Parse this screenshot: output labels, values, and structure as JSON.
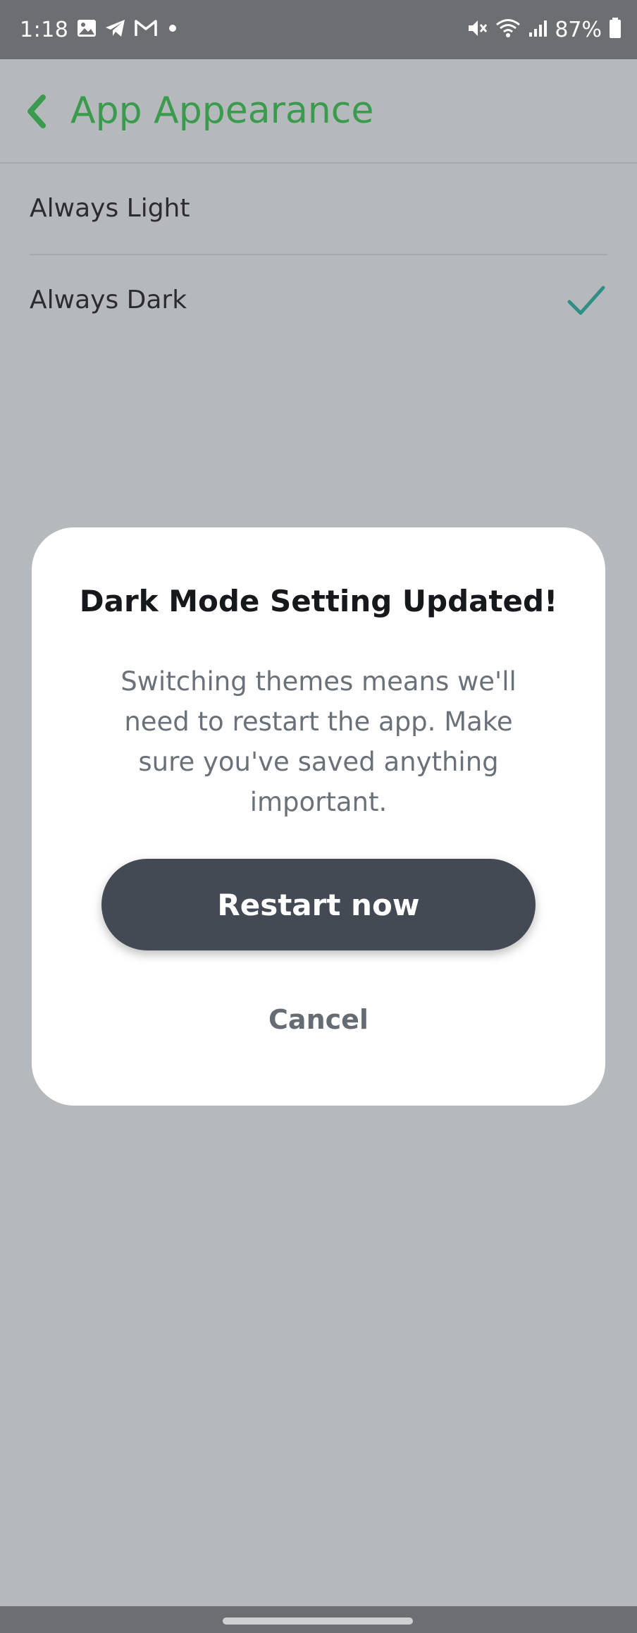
{
  "status_bar": {
    "time": "1:18",
    "battery_percent": "87%",
    "icons": [
      "gallery-icon",
      "telegram-icon",
      "gmail-icon",
      "dot-icon",
      "mute-icon",
      "wifi-icon",
      "signal-icon",
      "battery-icon"
    ]
  },
  "header": {
    "title": "App Appearance",
    "back_icon": "chevron-left-icon"
  },
  "options": [
    {
      "label": "Always Light",
      "selected": false
    },
    {
      "label": "Always Dark",
      "selected": true
    }
  ],
  "dialog": {
    "title": "Dark Mode Setting Updated!",
    "body": "Switching themes means we'll need to restart the app. Make sure you've saved anything important.",
    "primary_button": "Restart now",
    "secondary_button": "Cancel"
  },
  "colors": {
    "accent_green": "#3a9a4d",
    "check_teal": "#2f8f84",
    "button_dark": "#444a53",
    "scrim": "#b6b9bc"
  }
}
